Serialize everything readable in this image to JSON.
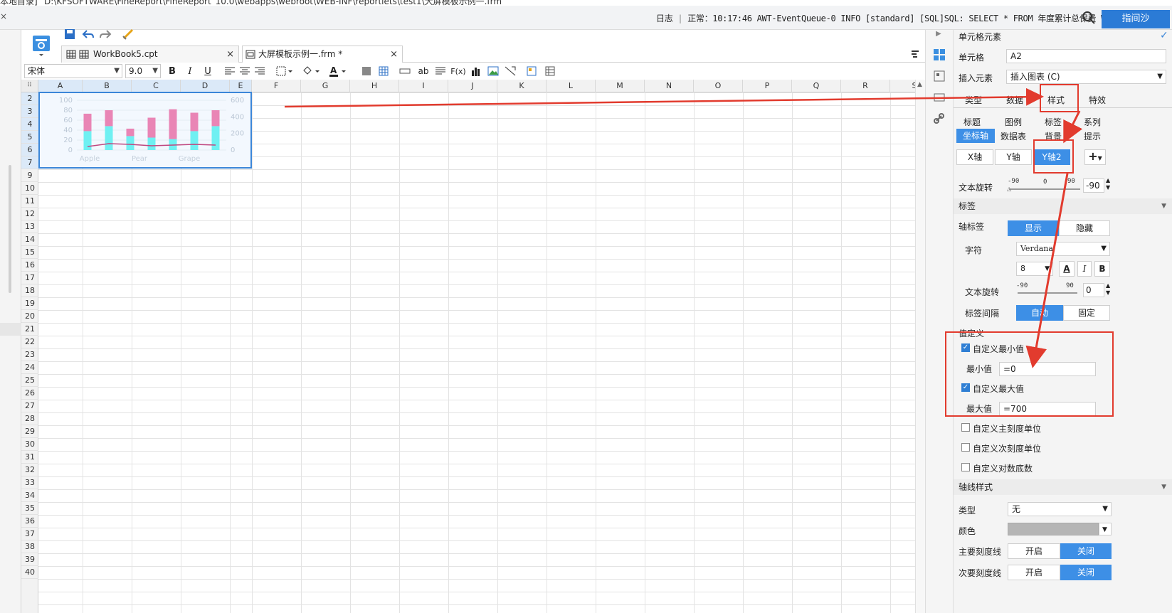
{
  "window": {
    "title_left": "本地目录]",
    "title_path": "D:\\KFSOFTWARE\\FineReport\\FineReport_10.0\\webapps\\webroot\\WEB-INF\\reportlets\\test1\\大屏模板示例一.frm"
  },
  "status": {
    "log_label": "日志",
    "log_text": "正常：10:17:46 AWT-EventQueue-0 INFO [standard] [SQL]SQL: SELECT * FROM 年度累计总保费 WHER...",
    "user_button": "指间沙"
  },
  "tabs": [
    {
      "label": "WorkBook5.cpt",
      "close": "×"
    },
    {
      "label": "大屏模板示例一.frm *",
      "close": "×"
    }
  ],
  "format": {
    "font": "宋体",
    "size": "9.0",
    "bold": "B",
    "italic": "I",
    "underline": "U",
    "text_glyph": "ab",
    "fx": "F(x)"
  },
  "sheet": {
    "columns": [
      "A",
      "B",
      "C",
      "D",
      "E",
      "F",
      "G",
      "H",
      "I",
      "J",
      "K",
      "L",
      "M",
      "N",
      "O",
      "P",
      "Q",
      "R",
      "S"
    ],
    "rows": [
      "2",
      "3",
      "4",
      "5",
      "6",
      "7",
      "9",
      "10",
      "11",
      "12",
      "13",
      "14",
      "15",
      "16",
      "17",
      "18",
      "19",
      "20",
      "21",
      "22",
      "23",
      "24",
      "25",
      "26",
      "27",
      "28",
      "29",
      "30",
      "31",
      "32",
      "33",
      "34",
      "35",
      "36",
      "37",
      "38",
      "39",
      "40"
    ]
  },
  "chart_data": {
    "type": "bar",
    "categories": [
      "Apple",
      "Pear",
      "Grape"
    ],
    "series": [
      {
        "values": [
          38,
          48,
          28,
          25,
          22,
          38,
          48
        ]
      },
      {
        "values": [
          35,
          32,
          15,
          40,
          60,
          37,
          32
        ]
      }
    ],
    "line_values": [
      25,
      45,
      40,
      30,
      35,
      40,
      35
    ],
    "y_ticks": [
      "100",
      "80",
      "60",
      "40",
      "20",
      "0"
    ],
    "y2_ticks": [
      "600",
      "400",
      "200",
      "0"
    ],
    "colors": {
      "cyan": "#6ff0f2",
      "pink": "#e985b5",
      "line": "#c0477f"
    }
  },
  "panel": {
    "header": "单元格元素",
    "cell_label": "单元格",
    "cell_value": "A2",
    "insert_label": "插入元素",
    "insert_value": "插入图表 (C)",
    "main_tabs": [
      "类型",
      "数据",
      "样式",
      "特效"
    ],
    "sub_tabs_row1": [
      "标题",
      "图例",
      "标签",
      "系列"
    ],
    "sub_tabs_row2": [
      "坐标轴",
      "数据表",
      "背景",
      "提示"
    ],
    "axis_tabs": [
      "X轴",
      "Y轴",
      "Y轴2"
    ],
    "add": "+",
    "text_rotate_label": "文本旋转",
    "rotate_min": "-90",
    "rotate_mid": "0",
    "rotate_max": "90",
    "rotate_value": "-90",
    "section_label": "标签",
    "axis_label_label": "轴标签",
    "show": "显示",
    "hide": "隐藏",
    "font_label": "字符",
    "font_value": "Verdana",
    "font_size": "8",
    "font_color": "A",
    "font_italic": "I",
    "font_bold": "B",
    "label_rotate_label": "文本旋转",
    "label_rotate_value": "0",
    "label_interval_label": "标签间隔",
    "auto": "自动",
    "fixed": "固定",
    "value_def_section": "值定义",
    "custom_min": "自定义最小值",
    "min_label": "最小值",
    "min_value": "=0",
    "custom_max": "自定义最大值",
    "max_label": "最大值",
    "max_value": "=700",
    "custom_major": "自定义主刻度单位",
    "custom_minor": "自定义次刻度单位",
    "custom_log": "自定义对数底数",
    "axis_style_section": "轴线样式",
    "type_label": "类型",
    "type_value": "无",
    "color_label": "颜色",
    "major_tick_label": "主要刻度线",
    "minor_tick_label": "次要刻度线",
    "on": "开启",
    "off": "关闭"
  }
}
